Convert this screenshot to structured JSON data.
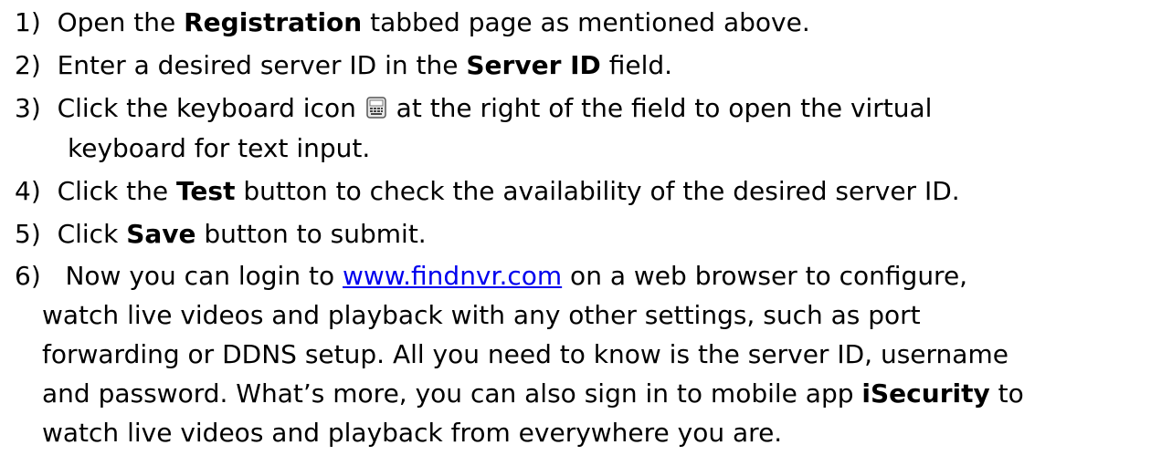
{
  "steps": [
    {
      "num": "1)",
      "pre": "Open the ",
      "bold": "Registration",
      "post": " tabbed page as mentioned above."
    },
    {
      "num": "2)",
      "pre": "Enter a desired server ID in the ",
      "bold": "Server ID",
      "post": " field."
    },
    {
      "num": "3)",
      "pre": "Click the keyboard icon ",
      "icon": "keyboard-icon",
      "post": " at the right of the field to open the virtual",
      "cont": "keyboard for text input."
    },
    {
      "num": "4)",
      "pre": "Click the ",
      "bold": "Test",
      "post": " button to check the availability of the desired server ID."
    },
    {
      "num": "5)",
      "pre": "Click ",
      "bold": "Save",
      "post": " button to submit."
    },
    {
      "num": "6)",
      "pre": "Now you can login to ",
      "link": "www.findnvr.com",
      "post": " on a web browser to configure,",
      "lines": [
        "watch live videos and playback with any other settings, such as port",
        "forwarding or DDNS setup. All you need to know is the server ID, username"
      ],
      "line4_pre": "and password. What’s more, you can also sign in to mobile app ",
      "line4_bold": "iSecurity",
      "line4_post": " to",
      "line5": "watch live videos and playback from everywhere you are."
    }
  ],
  "colors": {
    "text": "#000000",
    "link": "#0000ee"
  }
}
